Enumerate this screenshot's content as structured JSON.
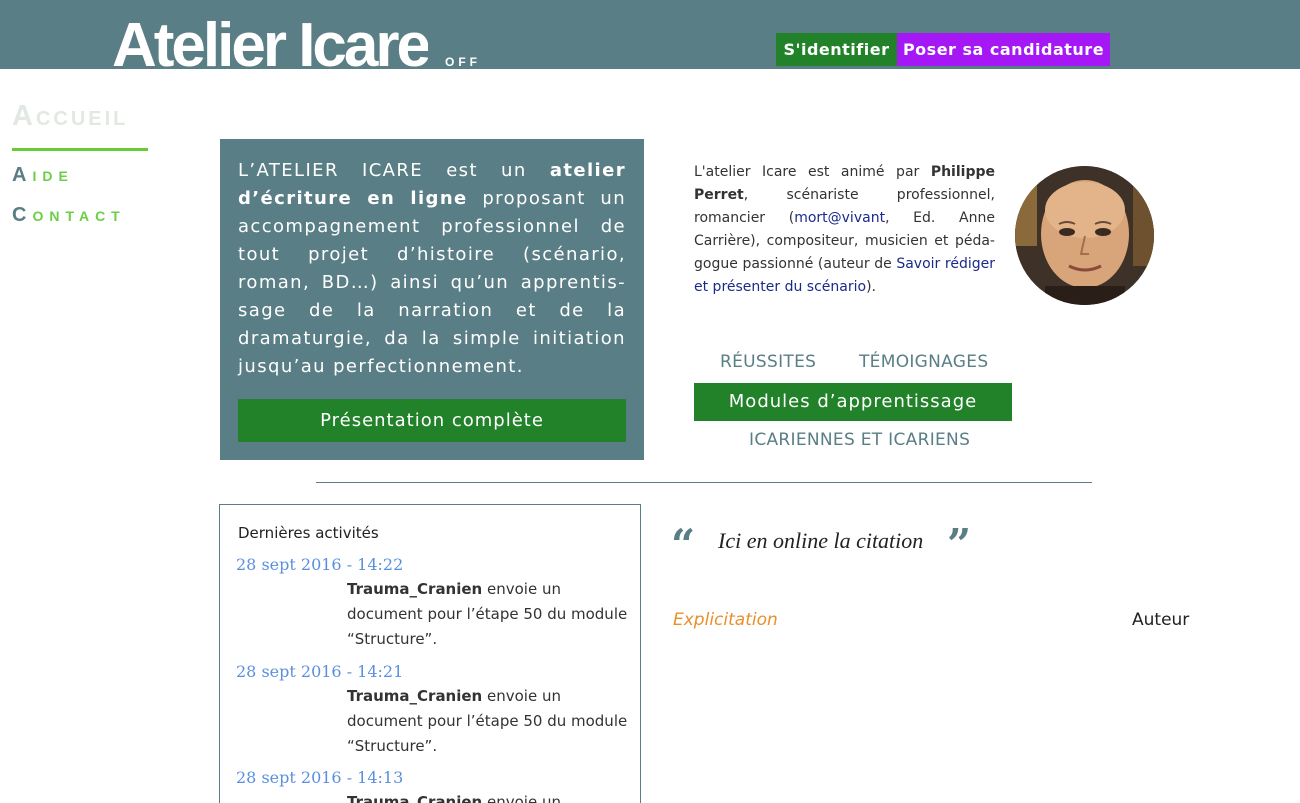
{
  "header": {
    "logo_text": "Atelier Icare",
    "logo_suffix": "OFF",
    "login_label": "S'identifier",
    "apply_label": "Poser sa candidature"
  },
  "nav": {
    "active": "Accueil",
    "items": [
      {
        "label": "Aide"
      },
      {
        "label": "Contact"
      }
    ]
  },
  "presentation": {
    "intro": "L’ATELIER ICARE est un ",
    "strong1": "atelier d’écriture en ligne",
    "body": " proposant un accompagnement professionnel de tout projet d’histoire (scénario, roman, BD…) ainsi qu’un apprentis-sage de la narration et de la dramaturgie, da la simple initiation jusqu’au perfectionnement.",
    "button_label": "Présentation complète"
  },
  "bio": {
    "t1": "L'atelier Icare est animé par ",
    "name": "Philippe Perret",
    "t2": ", scénariste professionnel, romancier (",
    "book1": "mort@vivant",
    "t3": ", Ed. Anne Carrière), compositeur, musicien et péda-gogue passionné (auteur de ",
    "book2": "Savoir rédiger et présenter du scénario",
    "t4": ")."
  },
  "links": {
    "reussites": "RÉUSSITES",
    "temoignages": "TÉMOIGNAGES",
    "modules": "Modules d’apprentissage",
    "icariens": "ICARIENNES ET ICARIENS"
  },
  "activity": {
    "title": "Dernières activités",
    "items": [
      {
        "date": "28 sept 2016 - 14:22",
        "user": "Trauma_Cranien",
        "text": " envoie un document pour l’étape 50 du module “Structure”."
      },
      {
        "date": "28 sept 2016 - 14:21",
        "user": "Trauma_Cranien",
        "text": " envoie un document pour l’étape 50 du module “Structure”."
      },
      {
        "date": "28 sept 2016 - 14:13",
        "user": "Trauma_Cranien",
        "text": " envoie un"
      }
    ]
  },
  "quote": {
    "open": "“",
    "text": "Ici en online la citation",
    "close": "”",
    "explicitation": "Explicitation",
    "author": "Auteur"
  },
  "colors": {
    "header": "#5a7e85",
    "green": "#22822a",
    "purple": "#a517f5",
    "nav_green": "#6bcf45",
    "date_blue": "#5b8fde",
    "orange": "#e8902a"
  }
}
